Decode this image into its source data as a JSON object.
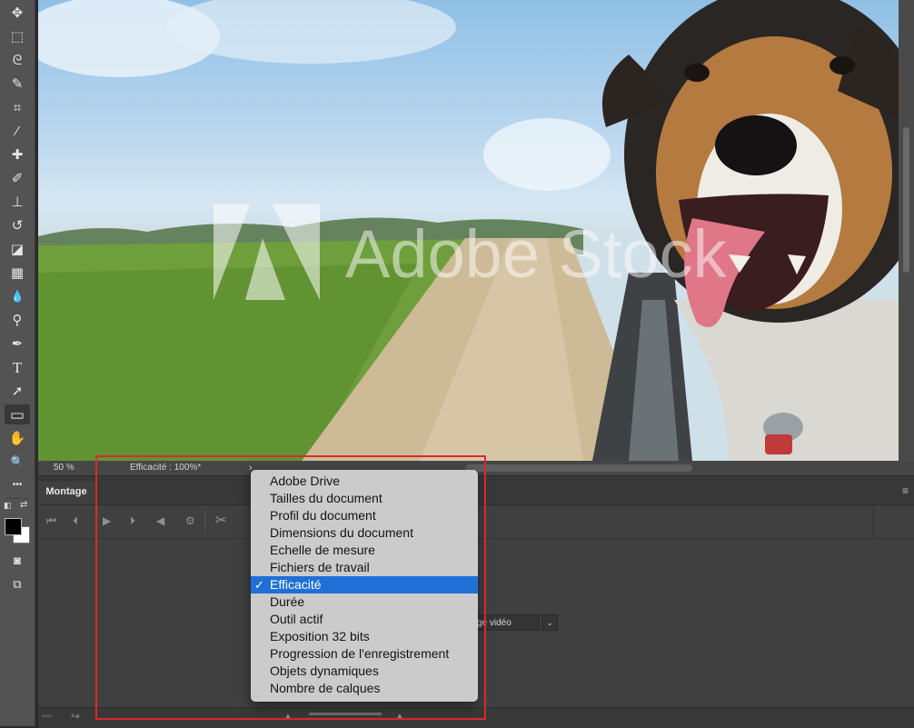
{
  "toolbar": {
    "tools": [
      {
        "name": "move-tool",
        "glyph": "✥"
      },
      {
        "name": "marquee-tool",
        "glyph": "⬚"
      },
      {
        "name": "lasso-tool",
        "glyph": "ᘓ"
      },
      {
        "name": "quick-selection-tool",
        "glyph": "✎"
      },
      {
        "name": "crop-tool",
        "glyph": "⌗"
      },
      {
        "name": "eyedropper-tool",
        "glyph": "⁄"
      },
      {
        "name": "healing-brush-tool",
        "glyph": "✚"
      },
      {
        "name": "brush-tool",
        "glyph": "✐"
      },
      {
        "name": "clone-stamp-tool",
        "glyph": "⊥"
      },
      {
        "name": "history-brush-tool",
        "glyph": "↺"
      },
      {
        "name": "eraser-tool",
        "glyph": "◪"
      },
      {
        "name": "gradient-tool",
        "glyph": "▦"
      },
      {
        "name": "blur-tool",
        "glyph": "💧"
      },
      {
        "name": "dodge-tool",
        "glyph": "⚲"
      },
      {
        "name": "pen-tool",
        "glyph": "✒"
      },
      {
        "name": "type-tool",
        "glyph": "T"
      },
      {
        "name": "path-selection-tool",
        "glyph": "➚"
      },
      {
        "name": "rectangle-tool",
        "glyph": "▭"
      },
      {
        "name": "hand-tool",
        "glyph": "✋"
      },
      {
        "name": "zoom-tool",
        "glyph": "🔍"
      },
      {
        "name": "more-tools",
        "glyph": "•••"
      }
    ],
    "fg_color": "#000000",
    "bg_color": "#ffffff"
  },
  "canvas": {
    "watermark": "Adobe Stock"
  },
  "statusbar": {
    "zoom": "50 %",
    "info": "Efficacité : 100%*",
    "arrow": "›"
  },
  "panel": {
    "tab": "Montage",
    "menu_icon": "≡",
    "video_select_value": "ge vidéo",
    "video_select_caret": "⌄"
  },
  "menu": {
    "items": [
      "Adobe Drive",
      "Tailles du document",
      "Profil du document",
      "Dimensions du document",
      "Echelle de mesure",
      "Fichiers de travail",
      "Efficacité",
      "Durée",
      "Outil actif",
      "Exposition 32 bits",
      "Progression de l'enregistrement",
      "Objets dynamiques",
      "Nombre de calques"
    ],
    "selected_index": 6,
    "check": "✓"
  },
  "colors": {
    "highlight": "#d9292d",
    "selection": "#1f6fd8"
  }
}
